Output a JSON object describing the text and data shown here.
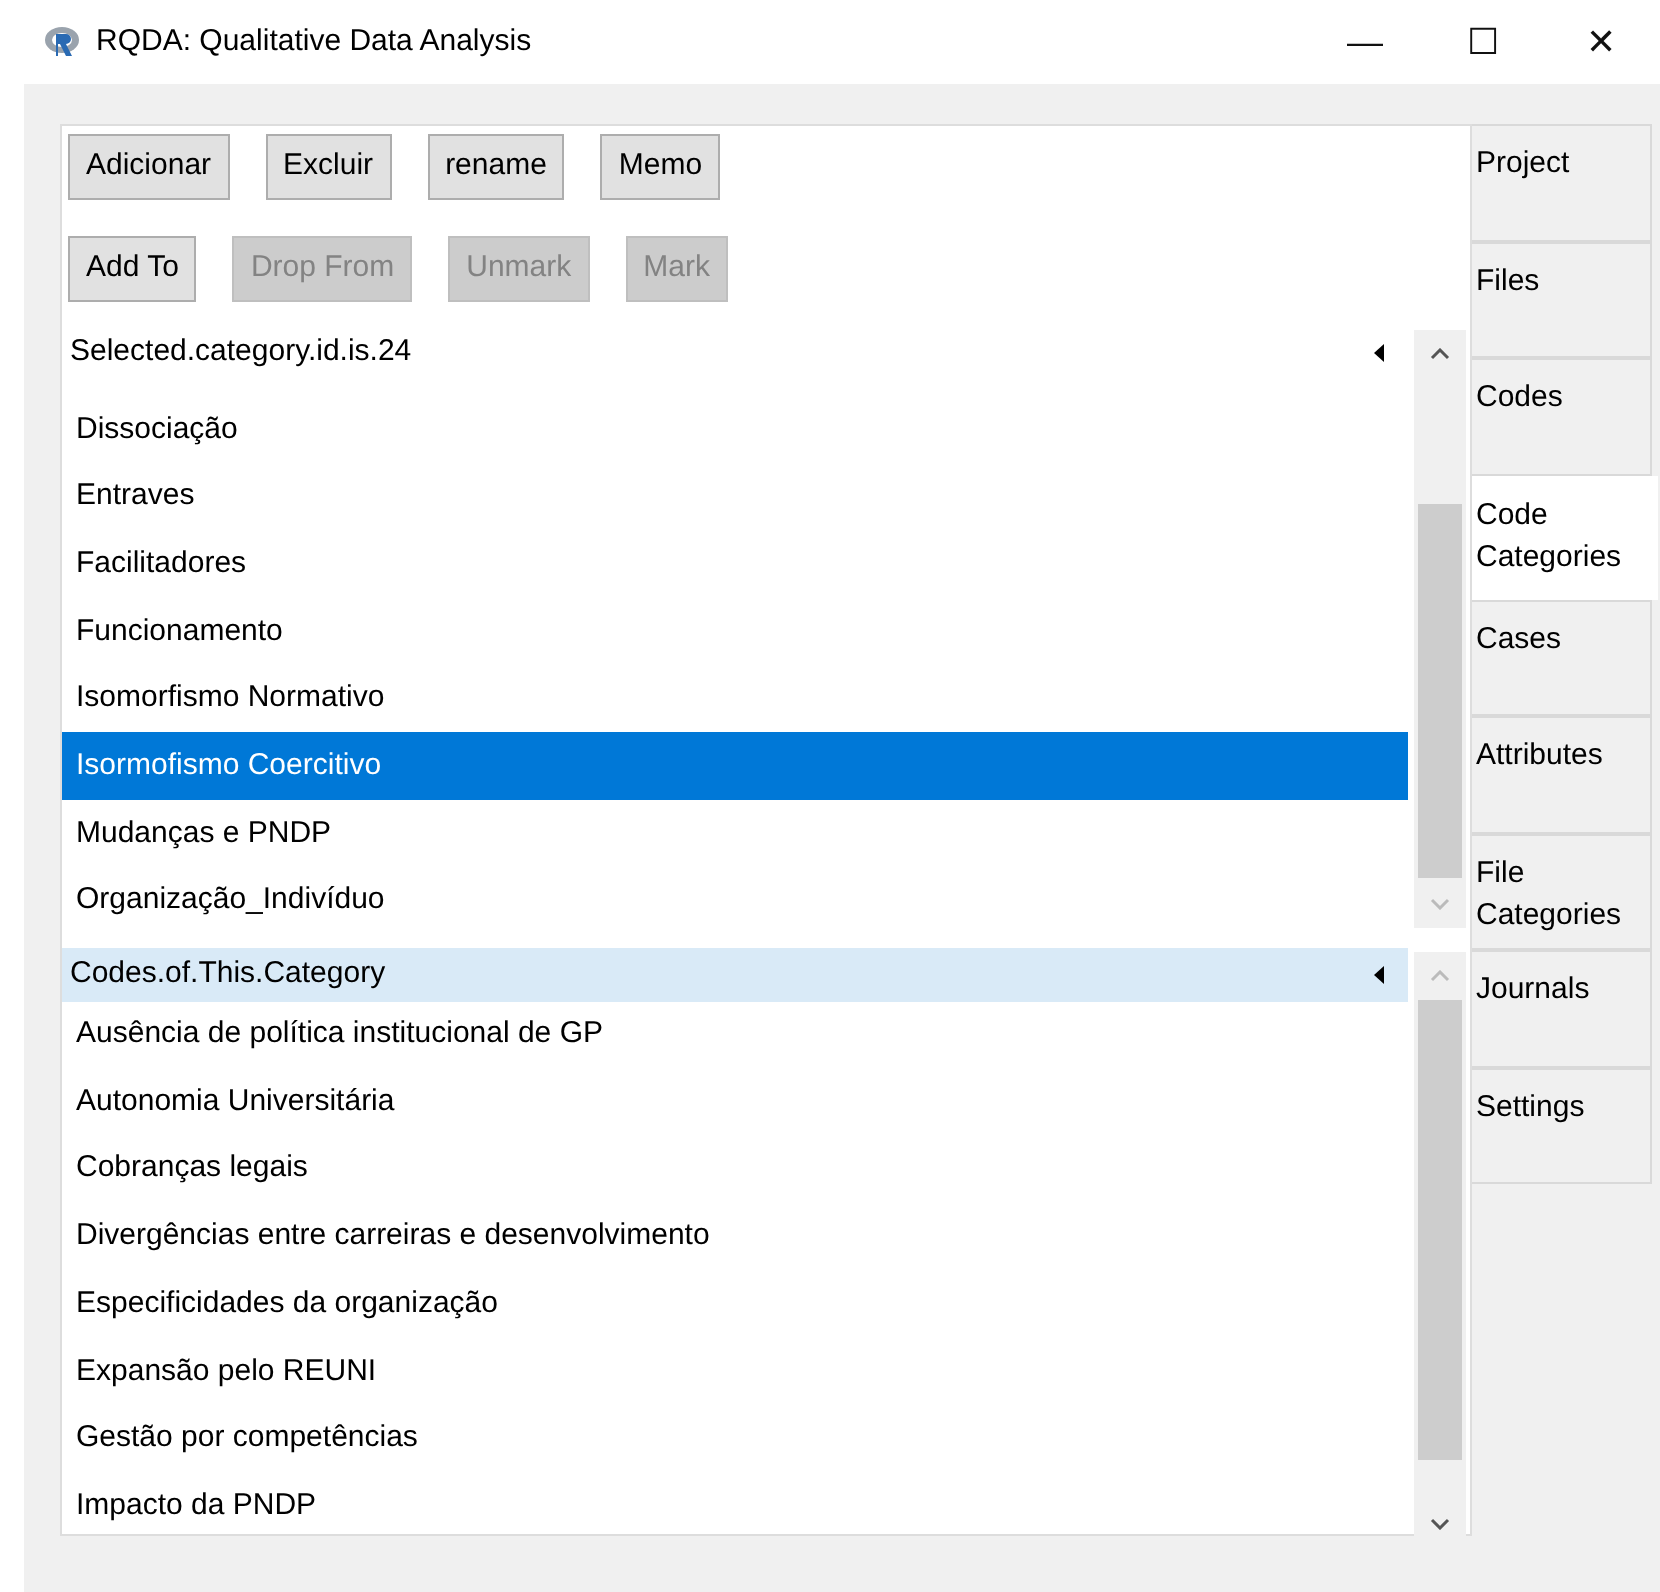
{
  "window": {
    "title": "RQDA: Qualitative Data Analysis",
    "controls": [
      "—",
      "☐",
      "✕"
    ]
  },
  "toolbar_rows": [
    [
      {
        "label": "Adicionar",
        "disabled": false
      },
      {
        "label": "Excluir",
        "disabled": false
      },
      {
        "label": "rename",
        "disabled": false
      },
      {
        "label": "Memo",
        "disabled": false
      }
    ],
    [
      {
        "label": "Add To",
        "disabled": false
      },
      {
        "label": "Drop From",
        "disabled": true
      },
      {
        "label": "Unmark",
        "disabled": true
      },
      {
        "label": "Mark",
        "disabled": true
      }
    ]
  ],
  "category_list": {
    "header": "Selected.category.id.is.24",
    "header_highlighted": false,
    "items": [
      {
        "label": "Dissociação",
        "selected": false
      },
      {
        "label": "Entraves",
        "selected": false
      },
      {
        "label": "Facilitadores",
        "selected": false
      },
      {
        "label": "Funcionamento",
        "selected": false
      },
      {
        "label": "Isomorfismo Normativo",
        "selected": false
      },
      {
        "label": "Isormofismo Coercitivo",
        "selected": true
      },
      {
        "label": "Mudanças e PNDP",
        "selected": false
      },
      {
        "label": "Organização_Indivíduo",
        "selected": false
      }
    ]
  },
  "codes_list": {
    "header": "Codes.of.This.Category",
    "header_highlighted": true,
    "items": [
      {
        "label": "Ausência de política institucional de GP",
        "selected": false
      },
      {
        "label": "Autonomia Universitária",
        "selected": false
      },
      {
        "label": "Cobranças legais",
        "selected": false
      },
      {
        "label": "Divergências entre carreiras e desenvolvimento",
        "selected": false
      },
      {
        "label": "Especificidades da organização",
        "selected": false
      },
      {
        "label": "Expansão pelo REUNI",
        "selected": false
      },
      {
        "label": "Gestão por competências",
        "selected": false
      },
      {
        "label": "Impacto da PNDP",
        "selected": false
      }
    ]
  },
  "tabs": [
    {
      "label": "Project",
      "selected": false
    },
    {
      "label": "Files",
      "selected": false
    },
    {
      "label": "Codes",
      "selected": false
    },
    {
      "label": "Code Categories",
      "selected": true
    },
    {
      "label": "Cases",
      "selected": false
    },
    {
      "label": "Attributes",
      "selected": false
    },
    {
      "label": "File Categories",
      "selected": false
    },
    {
      "label": "Journals",
      "selected": false
    },
    {
      "label": "Settings",
      "selected": false
    }
  ]
}
